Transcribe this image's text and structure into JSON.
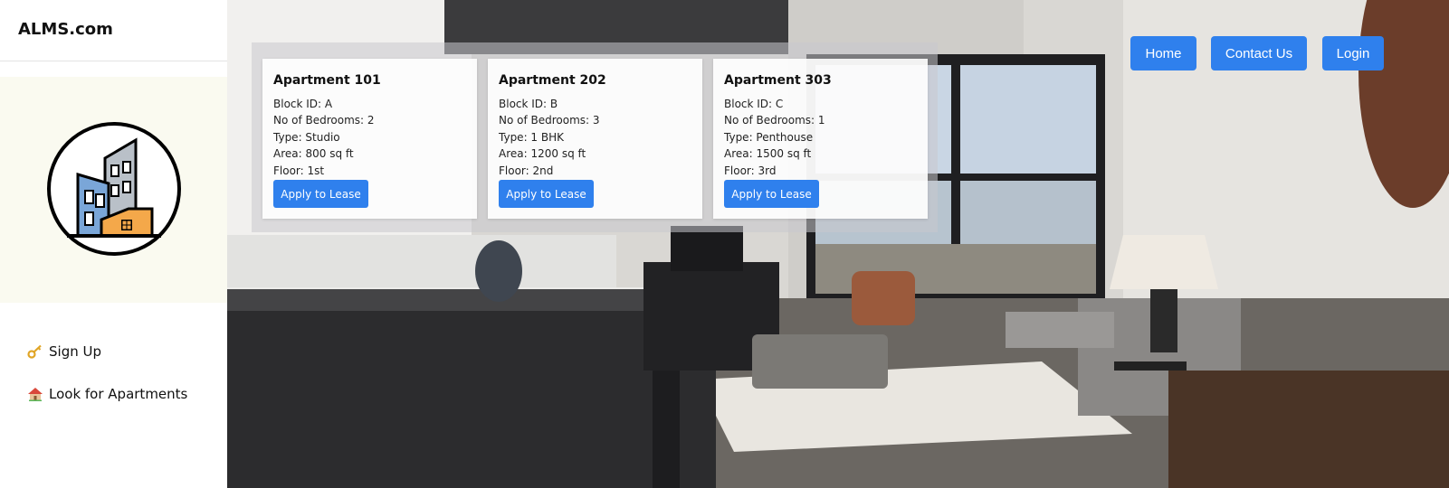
{
  "brand": "ALMS.com",
  "sidebar": {
    "items": [
      {
        "label": "Sign Up",
        "icon": "key-icon"
      },
      {
        "label": "Look for Apartments",
        "icon": "house-icon"
      }
    ]
  },
  "topnav": {
    "home": "Home",
    "contact": "Contact Us",
    "login": "Login"
  },
  "apartments": [
    {
      "title": "Apartment 101",
      "block": "Block ID: A",
      "bedrooms": "No of Bedrooms: 2",
      "type": "Type: Studio",
      "area": "Area: 800 sq ft",
      "floor": "Floor: 1st",
      "action": "Apply to Lease"
    },
    {
      "title": "Apartment 202",
      "block": "Block ID: B",
      "bedrooms": "No of Bedrooms: 3",
      "type": "Type: 1 BHK",
      "area": "Area: 1200 sq ft",
      "floor": "Floor: 2nd",
      "action": "Apply to Lease"
    },
    {
      "title": "Apartment 303",
      "block": "Block ID: C",
      "bedrooms": "No of Bedrooms: 1",
      "type": "Type: Penthouse",
      "area": "Area: 1500 sq ft",
      "floor": "Floor: 3rd",
      "action": "Apply to Lease"
    }
  ],
  "colors": {
    "accent": "#2f80ed",
    "sidebar_bg": "#ffffff",
    "logo_panel_bg": "#fafaf0"
  }
}
